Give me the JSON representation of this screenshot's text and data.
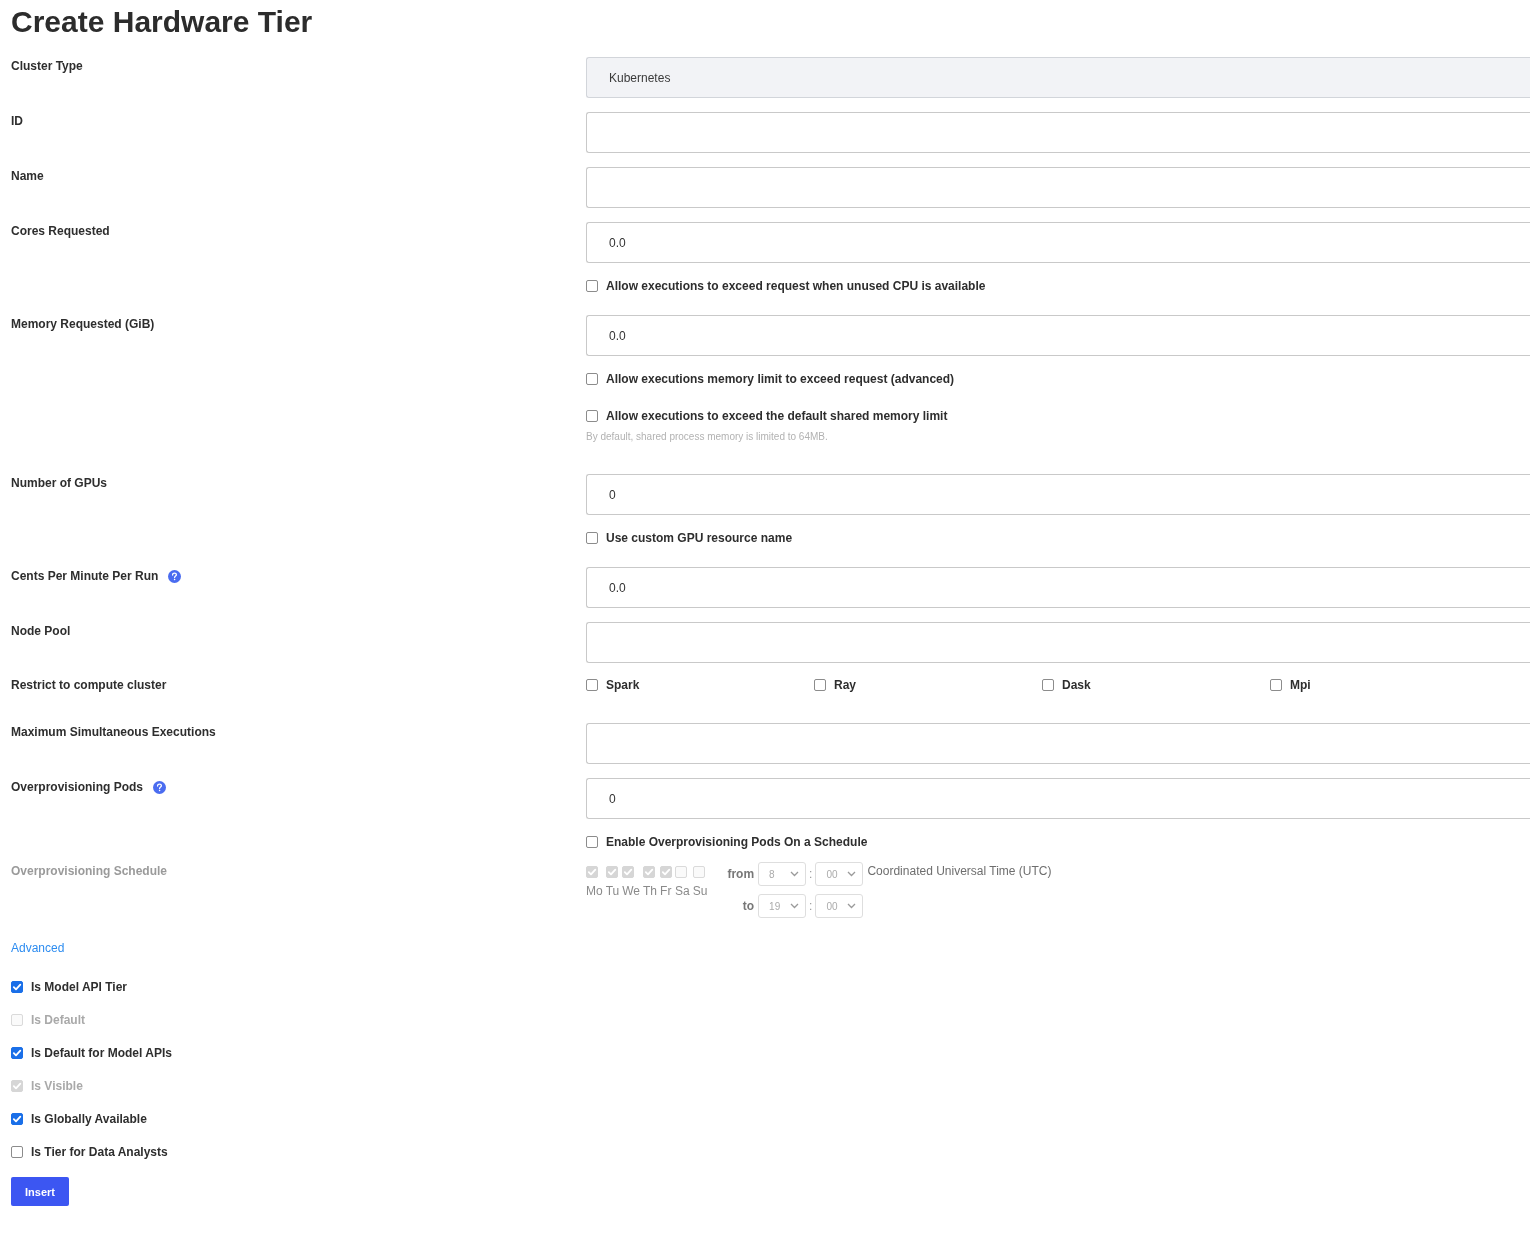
{
  "title": "Create Hardware Tier",
  "fields": [
    {
      "kind": "input",
      "label": "Cluster Type",
      "value": "Kubernetes",
      "readonly": true
    },
    {
      "kind": "input",
      "label": "ID"
    },
    {
      "kind": "input",
      "label": "Name"
    },
    {
      "kind": "input",
      "label": "Cores Requested",
      "value": "0.0",
      "options": [
        {
          "label": "Allow executions to exceed request when unused CPU is available",
          "checked": false
        }
      ]
    },
    {
      "kind": "input",
      "label": "Memory Requested (GiB)",
      "value": "0.0",
      "options": [
        {
          "label": "Allow executions memory limit to exceed request (advanced)",
          "checked": false
        },
        {
          "label": "Allow executions to exceed the default shared memory limit",
          "checked": false,
          "hint": "By default, shared process memory is limited to 64MB."
        }
      ]
    },
    {
      "kind": "input",
      "label": "Number of GPUs",
      "value": "0",
      "options": [
        {
          "label": "Use custom GPU resource name",
          "checked": false
        }
      ]
    },
    {
      "kind": "input",
      "label": "Cents Per Minute Per Run",
      "help": true,
      "value": "0.0"
    },
    {
      "kind": "input",
      "label": "Node Pool"
    },
    {
      "kind": "checkbox-group",
      "label": "Restrict to compute cluster",
      "options": [
        {
          "label": "Spark",
          "checked": false
        },
        {
          "label": "Ray",
          "checked": false
        },
        {
          "label": "Dask",
          "checked": false
        },
        {
          "label": "Mpi",
          "checked": false
        }
      ]
    },
    {
      "kind": "input",
      "label": "Maximum Simultaneous Executions"
    },
    {
      "kind": "input",
      "label": "Overprovisioning Pods",
      "help": true,
      "value": "0",
      "options": [
        {
          "label": "Enable Overprovisioning Pods On a Schedule",
          "checked": false
        }
      ]
    },
    {
      "kind": "schedule",
      "label": "Overprovisioning Schedule",
      "disabled": true,
      "days": [
        {
          "label": "Mo",
          "checked": true
        },
        {
          "label": "Tu",
          "checked": true
        },
        {
          "label": "We",
          "checked": true
        },
        {
          "label": "Th",
          "checked": true
        },
        {
          "label": "Fr",
          "checked": true
        },
        {
          "label": "Sa",
          "checked": false
        },
        {
          "label": "Su",
          "checked": false
        }
      ],
      "from": {
        "label": "from",
        "hour": "8",
        "separator": ":",
        "minute": "00",
        "timezone": "Coordinated Universal Time (UTC)"
      },
      "to": {
        "label": "to",
        "hour": "19",
        "separator": ":",
        "minute": "00"
      }
    }
  ],
  "advanced_link": "Advanced",
  "flags": [
    {
      "label": "Is Model API Tier",
      "checked": true,
      "disabled": false
    },
    {
      "label": "Is Default",
      "checked": false,
      "disabled": true
    },
    {
      "label": "Is Default for Model APIs",
      "checked": true,
      "disabled": false
    },
    {
      "label": "Is Visible",
      "checked": true,
      "disabled": true
    },
    {
      "label": "Is Globally Available",
      "checked": true,
      "disabled": false
    },
    {
      "label": "Is Tier for Data Analysts",
      "checked": false,
      "disabled": false
    }
  ],
  "submit_button": "Insert"
}
